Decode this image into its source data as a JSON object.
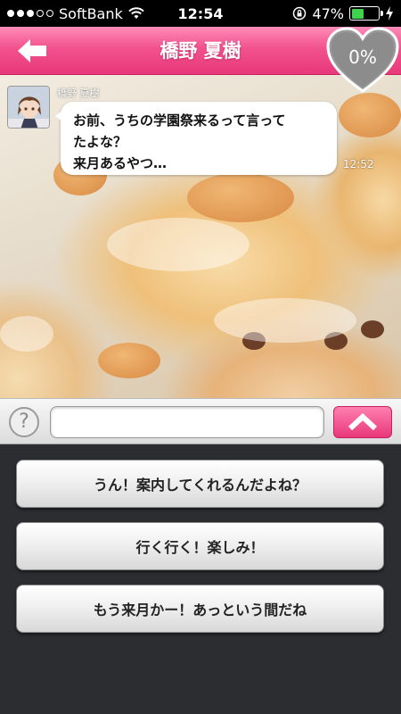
{
  "status_bar": {
    "carrier": "SoftBank",
    "time": "12:54",
    "battery_percent": "47%",
    "battery_level": 0.47,
    "signal_bars_filled": 3,
    "signal_bars_total": 5
  },
  "header": {
    "title": "橋野 夏樹",
    "affection": "0%",
    "accent_color": "#e8387a"
  },
  "chat": {
    "messages": [
      {
        "sender": "橋野 夏樹",
        "lines": [
          "お前、うちの学園祭来るって言って",
          "たよな？",
          "来月あるやつ…"
        ],
        "time": "12:52"
      }
    ]
  },
  "input": {
    "help_label": "?",
    "value": "",
    "placeholder": ""
  },
  "choices": [
    {
      "label": "うん！案内してくれるんだよね？"
    },
    {
      "label": "行く行く！楽しみ！"
    },
    {
      "label": "もう来月かー！あっという間だね"
    }
  ],
  "icons": {
    "back": "back-arrow-icon",
    "send": "chevron-up-icon",
    "heart": "heart-icon",
    "wifi": "wifi-icon",
    "lock": "rotation-lock-icon",
    "bolt": "charging-bolt-icon"
  }
}
